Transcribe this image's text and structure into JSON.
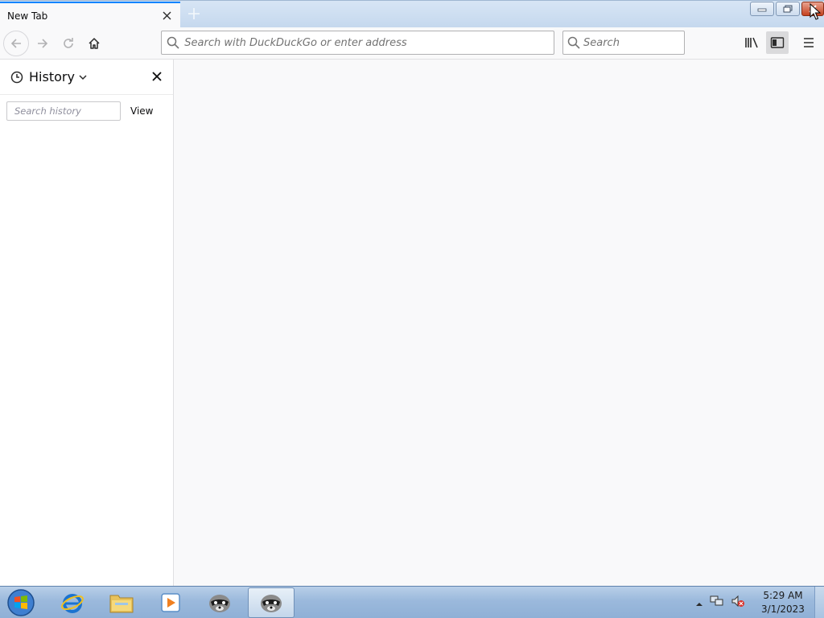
{
  "browser": {
    "tab": {
      "title": "New Tab"
    },
    "url_bar": {
      "placeholder": "Search with DuckDuckGo or enter address"
    },
    "search_bar": {
      "placeholder": "Search"
    }
  },
  "sidebar": {
    "title": "History",
    "search_placeholder": "Search history",
    "view_label": "View"
  },
  "taskbar": {
    "apps": [
      "start-orb-icon",
      "internet-explorer-icon",
      "file-explorer-icon",
      "media-player-icon",
      "raccoon-app-icon",
      "raccoon-app-icon"
    ],
    "clock": {
      "time": "5:29 AM",
      "date": "3/1/2023"
    }
  },
  "colors": {
    "accent": "#0a84ff",
    "toolbar_bg": "#f9f9fa",
    "taskbar": "#9bb9dc",
    "close_button": "#c4411e"
  }
}
